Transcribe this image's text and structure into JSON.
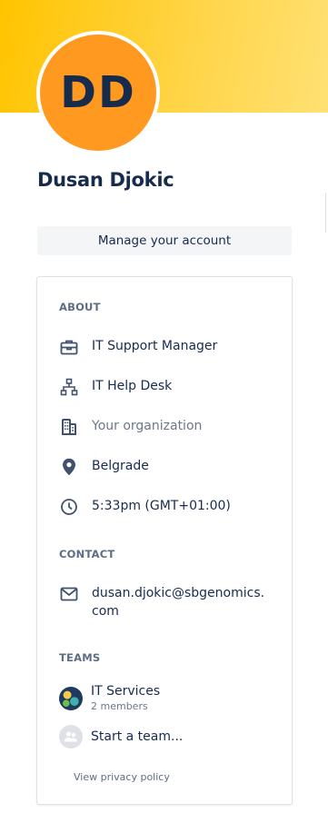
{
  "profile": {
    "initials": "DD",
    "name": "Dusan Djokic",
    "avatar_color": "#ff991f",
    "banner_color": "#ffc400"
  },
  "manage_account_label": "Manage your account",
  "about": {
    "title": "ABOUT",
    "job_title": "IT Support Manager",
    "department": "IT Help Desk",
    "organization_placeholder": "Your organization",
    "location": "Belgrade",
    "local_time": "5:33pm (GMT+01:00)"
  },
  "contact": {
    "title": "CONTACT",
    "email": "dusan.djokic@sbgenomics.com"
  },
  "teams": {
    "title": "TEAMS",
    "items": [
      {
        "name": "IT Services",
        "members": "2 members",
        "icon": "team-avatar"
      }
    ],
    "start_team_label": "Start a team..."
  },
  "privacy_link": "View privacy policy",
  "icons": {
    "job": "briefcase-icon",
    "department": "org-chart-icon",
    "organization": "office-building-icon",
    "location": "location-pin-icon",
    "time": "clock-icon",
    "email": "email-icon",
    "start_team": "people-icon"
  }
}
